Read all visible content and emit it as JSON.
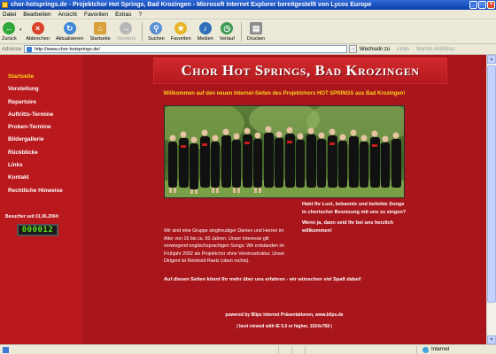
{
  "window": {
    "title": "chor-hotsprings.de - Projektchor Hot Springs, Bad Krozingen - Microsoft Internet Explorer bereitgestellt von Lycos Europe",
    "controls": [
      "_",
      "□",
      "×"
    ]
  },
  "menubar": {
    "items": [
      "Datei",
      "Bearbeiten",
      "Ansicht",
      "Favoriten",
      "Extras",
      "?"
    ]
  },
  "toolbar": {
    "back": "Zurück",
    "forward": "Vorwärts",
    "stop": "Abbrechen",
    "refresh": "Aktualisieren",
    "home": "Startseite",
    "search": "Suchen",
    "favorites": "Favoriten",
    "media": "Medien",
    "history": "Verlauf",
    "print": "Drucken"
  },
  "addressbar": {
    "label": "Adresse",
    "url": "http://www.chor-hotsprings.de/",
    "go": "→",
    "wechseln": "Wechseln zu",
    "links": "Links",
    "norton": "Norton AntiVirus"
  },
  "site": {
    "nav": [
      "Startseite",
      "Vorstellung",
      "Repertoire",
      "Auftritts-Termine",
      "Proben-Termine",
      "Bildergallerie",
      "Rückblicke",
      "Links",
      "Kontakt",
      "Rechtliche Hinweise"
    ],
    "counter_label": "Besucher seit 01.06.2004:",
    "counter_value": "000012",
    "header_title": "Chor Hot Springs, Bad Krozingen",
    "welcome": "Willkommen auf den neuen Internet-Seiten des Projektchors HOT SPRINGS aus Bad Krozingen!",
    "intro": "Wir sind eine Gruppe singfreudiger Damen und Herren im Alter von 16 bis ca. 50 Jahren. Unser Interesse gilt vorwiegend englischsprachigen Songs. Wir entstanden im Frühjahr 2002 als Projektchor ohne Vereinsstruktur. Unser Dirigent ist Reinhold Raetz (oben rechts).",
    "promo1": "Habt Ihr Lust, bekannte und beliebte Songs in chorischer Besetzung mit uns zu singen?",
    "promo2": "Wenn ja, dann seid Ihr bei uns herzlich willkommen!",
    "closing": "Auf diesen Seiten könnt Ihr mehr über uns erfahren - wir wünschen viel Spaß dabei!",
    "powered": "powered by Blips Internet Präsentationen, www.blips.de",
    "bestviewed": "| best viewed with IE 5.0 or higher, 1024x768 |"
  },
  "statusbar": {
    "zone": "Internet"
  },
  "colors": {
    "page_bg": "#a8161b",
    "sidebar_bg": "#b9181d",
    "accent_yellow": "#ffd21a",
    "counter_green": "#59e01a"
  }
}
